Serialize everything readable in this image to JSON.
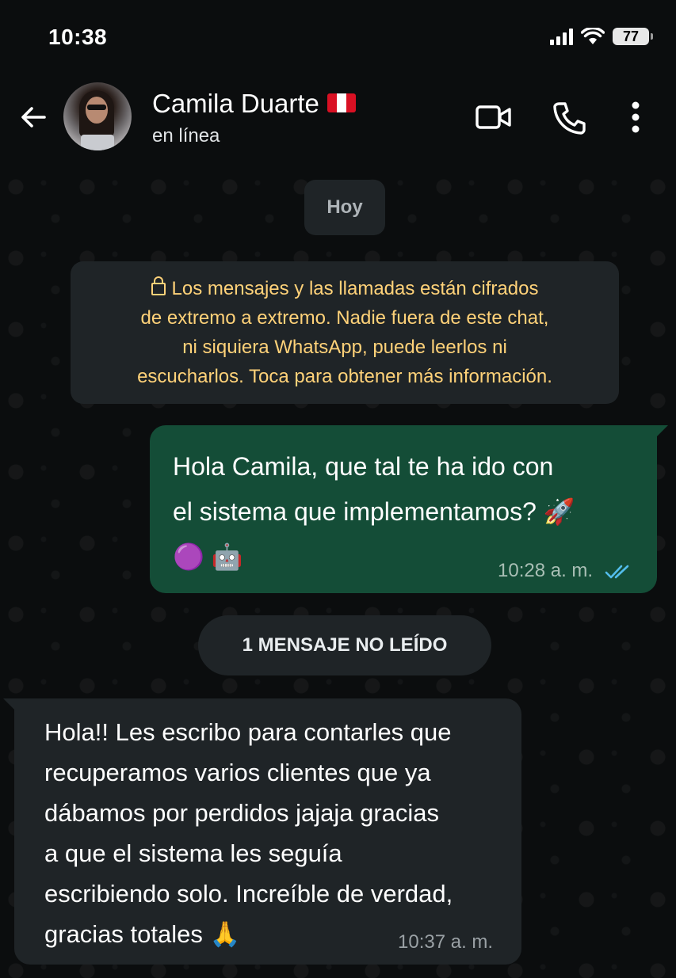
{
  "status_bar": {
    "time": "10:38",
    "battery": "77"
  },
  "header": {
    "contact_name": "Camila Duarte",
    "flag_icon": "peru-flag-icon",
    "presence": "en línea",
    "icons": [
      "back-arrow-icon",
      "video-call-icon",
      "phone-icon",
      "more-vert-icon"
    ]
  },
  "chat": {
    "date_label": "Hoy",
    "encryption_notice": {
      "lines": [
        "Los mensajes y las llamadas están cifrados",
        "de extremo a extremo. Nadie fuera de este chat,",
        "ni siquiera WhatsApp, puede leerlos ni",
        "escucharlos. Toca para obtener más información."
      ],
      "color": "#ffd279"
    },
    "outgoing_message": {
      "lines": [
        "Hola Camila, que tal te ha ido con",
        "el sistema que implementamos? 🚀",
        "🟣 🤖"
      ],
      "time": "10:28 a. m.",
      "status": "read",
      "bubble_color": "#144d37",
      "tick_color": "#53bdeb"
    },
    "unread_label": "1 MENSAJE NO LEÍDO",
    "incoming_message": {
      "lines": [
        "Hola!! Les escribo para contarles que",
        "recuperamos varios clientes que ya",
        "dábamos por perdidos jajaja gracias",
        "a que el sistema les seguía",
        "escribiendo solo. Increíble de verdad,",
        "gracias totales 🙏"
      ],
      "time": "10:37 a. m.",
      "bubble_color": "#1f2427"
    }
  }
}
